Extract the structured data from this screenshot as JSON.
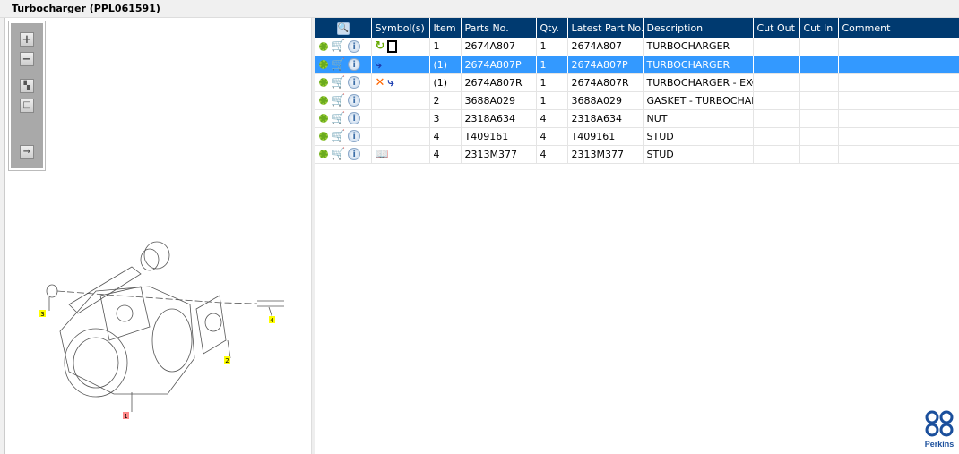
{
  "window": {
    "title": "Turbocharger (PPL061591)"
  },
  "toolbox": {
    "zoom_in": "+",
    "zoom_out": "−"
  },
  "table": {
    "headers": [
      "",
      "Symbol(s)",
      "Item",
      "Parts No.",
      "Qty.",
      "Latest Part No.",
      "Description",
      "Cut Out",
      "Cut In",
      "Comment"
    ],
    "rows": [
      {
        "symbols": [
          "replaced-icon",
          "document-icon"
        ],
        "item": "1",
        "part": "2674A807",
        "qty": "1",
        "latest": "2674A807",
        "desc": "TURBOCHARGER",
        "cut_out": "",
        "cut_in": "",
        "comment": ""
      },
      {
        "symbols": [
          "branch-icon"
        ],
        "item": "(1)",
        "part": "2674A807P",
        "qty": "1",
        "latest": "2674A807P",
        "desc": "TURBOCHARGER",
        "cut_out": "",
        "cut_in": "",
        "comment": "",
        "selected": true
      },
      {
        "symbols": [
          "cross-icon",
          "branch-icon"
        ],
        "item": "(1)",
        "part": "2674A807R",
        "qty": "1",
        "latest": "2674A807R",
        "desc": "TURBOCHARGER - EXCH",
        "cut_out": "",
        "cut_in": "",
        "comment": ""
      },
      {
        "symbols": [],
        "item": "2",
        "part": "3688A029",
        "qty": "1",
        "latest": "3688A029",
        "desc": "GASKET - TURBOCHARG",
        "cut_out": "",
        "cut_in": "",
        "comment": ""
      },
      {
        "symbols": [],
        "item": "3",
        "part": "2318A634",
        "qty": "4",
        "latest": "2318A634",
        "desc": "NUT",
        "cut_out": "",
        "cut_in": "",
        "comment": ""
      },
      {
        "symbols": [],
        "item": "4",
        "part": "T409161",
        "qty": "4",
        "latest": "T409161",
        "desc": "STUD",
        "cut_out": "",
        "cut_in": "",
        "comment": ""
      },
      {
        "symbols": [
          "book-search-icon"
        ],
        "item": "4",
        "part": "2313M377",
        "qty": "4",
        "latest": "2313M377",
        "desc": "STUD",
        "cut_out": "",
        "cut_in": "",
        "comment": ""
      }
    ]
  },
  "drawing": {
    "callouts": [
      "1",
      "2",
      "3",
      "4"
    ]
  },
  "brand": {
    "name": "Perkins",
    "color": "#1b4f9c"
  },
  "colors": {
    "header": "#003a70",
    "selected": "#3399ff"
  }
}
